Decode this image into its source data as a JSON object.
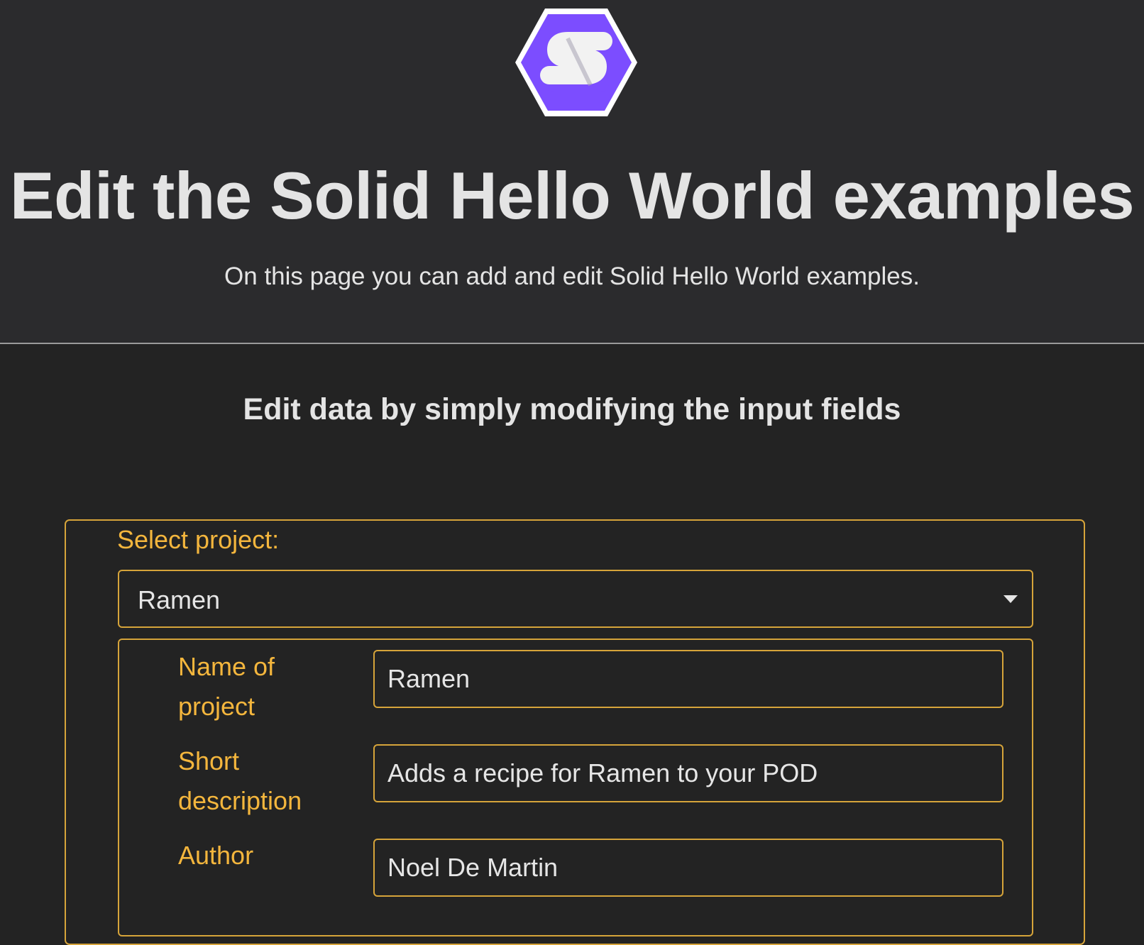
{
  "header": {
    "title": "Edit the Solid Hello World examples",
    "subtitle": "On this page you can add and edit Solid Hello World examples.",
    "logo_icon": "solid-logo-icon",
    "logo_letter": "S",
    "logo_color": "#7c4dff"
  },
  "main": {
    "heading": "Edit data by simply modifying the input fields",
    "select": {
      "label": "Select project:",
      "value": "Ramen"
    },
    "fields": [
      {
        "label": "Name of project",
        "value": "Ramen"
      },
      {
        "label": "Short description",
        "value": "Adds a recipe for Ramen to your POD"
      },
      {
        "label": "Author",
        "value": "Noel De Martin"
      }
    ]
  },
  "colors": {
    "accent": "#f4b63d",
    "border": "#d6a43a",
    "background": "#232323",
    "header_background": "#2b2b2d"
  }
}
